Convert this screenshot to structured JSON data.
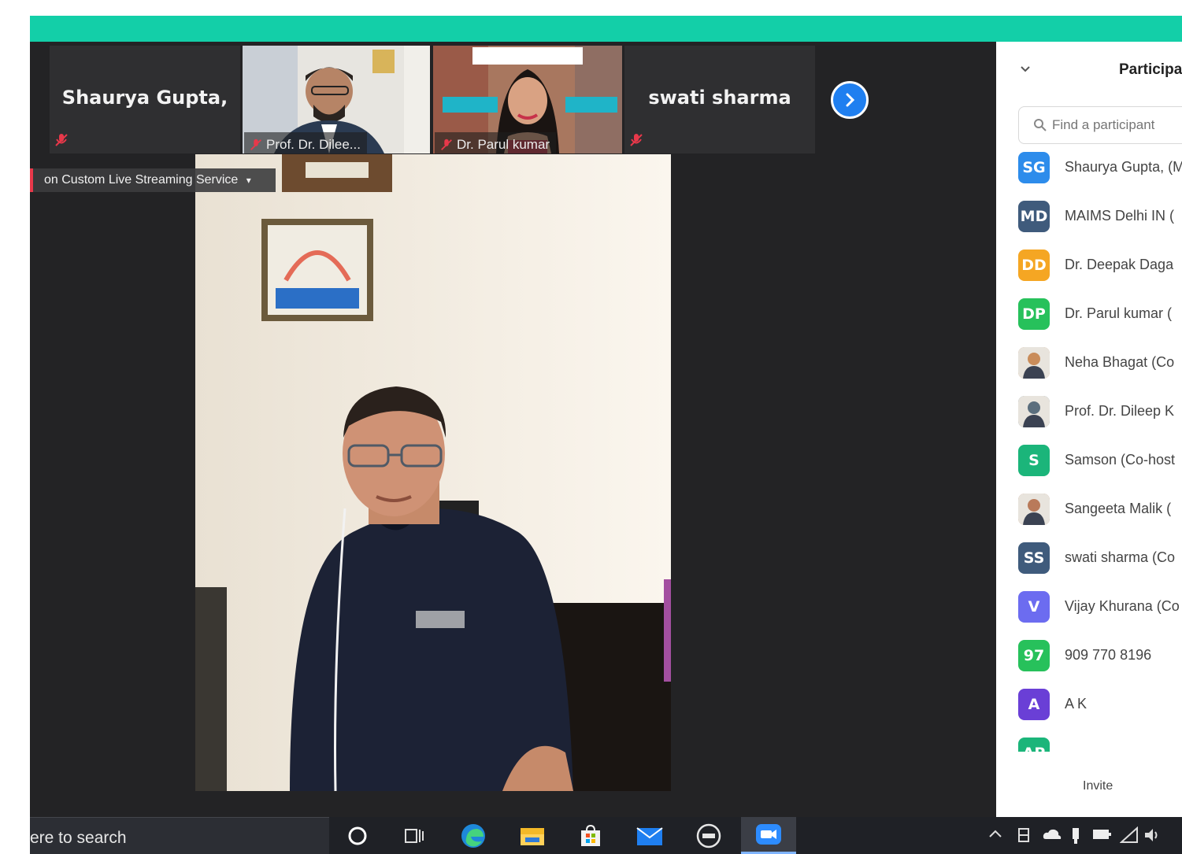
{
  "colors": {
    "accent": "#13cfa8",
    "arrow": "#1f7ff0",
    "muted": "#e8384a"
  },
  "gallery": {
    "tiles": [
      {
        "name": "Shaurya Gupta,",
        "type": "name"
      },
      {
        "name": "Prof. Dr. Dilee...",
        "type": "video"
      },
      {
        "name": "Dr. Parul kumar",
        "type": "video"
      },
      {
        "name": "swati sharma",
        "type": "name"
      }
    ],
    "next_icon": "chevron-right-icon"
  },
  "stream_label": "on Custom Live Streaming Service",
  "panel": {
    "title": "Participa",
    "search_placeholder": "Find a participant",
    "invite_label": "Invite",
    "participants": [
      {
        "initials": "SG",
        "name": "Shaurya Gupta, (M",
        "color": "#2d8ceb"
      },
      {
        "initials": "MD",
        "name": "MAIMS Delhi IN (",
        "color": "#3f5b7c"
      },
      {
        "initials": "DD",
        "name": "Dr. Deepak Daga",
        "color": "#f5a623"
      },
      {
        "initials": "DP",
        "name": "Dr. Parul kumar (",
        "color": "#27c15b"
      },
      {
        "initials": "",
        "name": "Neha Bhagat (Co",
        "color": "#c98c5a",
        "photo": true
      },
      {
        "initials": "",
        "name": "Prof. Dr. Dileep K",
        "color": "#5b6e7d",
        "photo": true
      },
      {
        "initials": "S",
        "name": "Samson (Co-host",
        "color": "#1bb57a"
      },
      {
        "initials": "",
        "name": "Sangeeta Malik (",
        "color": "#b97a5a",
        "photo": true
      },
      {
        "initials": "SS",
        "name": "swati sharma (Co",
        "color": "#3f5b7c"
      },
      {
        "initials": "V",
        "name": "Vijay Khurana (Co",
        "color": "#6c6cf0"
      },
      {
        "initials": "97",
        "name": "909 770 8196",
        "color": "#27c15b"
      },
      {
        "initials": "A",
        "name": "A K",
        "color": "#6a3fd6"
      },
      {
        "initials": "AP",
        "name": "",
        "color": "#1bb57a"
      }
    ]
  },
  "taskbar": {
    "search_text": "ere to search",
    "apps": [
      "cortana-icon",
      "task-view-icon",
      "edge-icon",
      "file-explorer-icon",
      "store-icon",
      "mail-icon",
      "dell-icon",
      "zoom-icon"
    ]
  }
}
